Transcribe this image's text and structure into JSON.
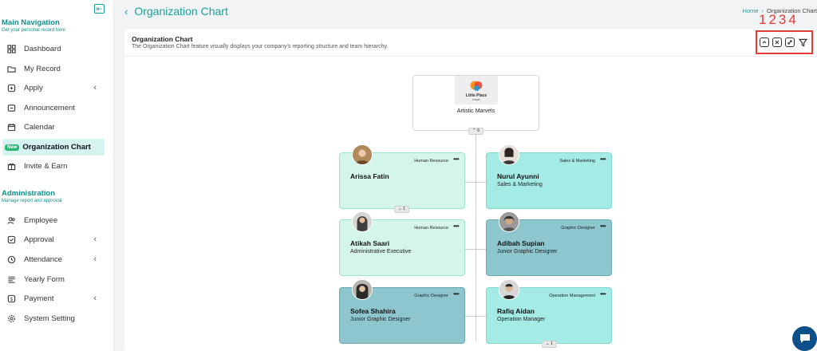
{
  "sidebar": {
    "main_nav": {
      "title": "Main Navigation",
      "subtitle": "Get your personal record here",
      "items": [
        {
          "label": "Dashboard",
          "icon": "grid-icon"
        },
        {
          "label": "My Record",
          "icon": "folder-icon"
        },
        {
          "label": "Apply",
          "icon": "apply-icon",
          "chevron": "‹"
        },
        {
          "label": "Announcement",
          "icon": "announcement-icon"
        },
        {
          "label": "Calendar",
          "icon": "calendar-icon"
        },
        {
          "label": "Organization Chart",
          "icon": "org-chart-icon",
          "badge": "New",
          "active": true
        },
        {
          "label": "Invite & Earn",
          "icon": "gift-icon"
        }
      ]
    },
    "admin": {
      "title": "Administration",
      "subtitle": "Manage report and approval",
      "items": [
        {
          "label": "Employee",
          "icon": "users-icon"
        },
        {
          "label": "Approval",
          "icon": "check-icon",
          "chevron": "‹"
        },
        {
          "label": "Attendance",
          "icon": "clock-icon",
          "chevron": "‹"
        },
        {
          "label": "Yearly Form",
          "icon": "form-icon"
        },
        {
          "label": "Payment",
          "icon": "dollar-icon",
          "chevron": "‹"
        },
        {
          "label": "System Setting",
          "icon": "gear-icon"
        }
      ]
    }
  },
  "header": {
    "title": "Organization Chart",
    "breadcrumb": {
      "home": "Home",
      "current": "Organization Chart"
    }
  },
  "card": {
    "title": "Organization Chart",
    "description": "The Organization Chart feature visually displays your company's reporting structure and team hierarchy.",
    "annotation_numbers": "1234",
    "toolbar": [
      "collapse-up-icon",
      "fit-screen-icon",
      "expand-icon",
      "filter-icon"
    ]
  },
  "org": {
    "root": {
      "logo_text_1": "Little Place",
      "logo_text_2": "START",
      "name": "Artistic Marvels",
      "expand": "⌃ 6"
    },
    "employees": [
      {
        "name": "Arissa Fatin",
        "role": "",
        "dept": "Human Resource",
        "color": "mint",
        "expand": "⌄ 1"
      },
      {
        "name": "Nurul Ayunni",
        "role": "Sales & Marketing",
        "dept": "Sales & Marketing",
        "color": "aqua"
      },
      {
        "name": "Atikah Saari",
        "role": "Administrative Executive",
        "dept": "Human Resource",
        "color": "mint"
      },
      {
        "name": "Adibah Supian",
        "role": "Junior Graphic Designer",
        "dept": "Graphic Designer",
        "color": "teal"
      },
      {
        "name": "Sofea Shahira",
        "role": "Junior Graphic Designer",
        "dept": "Graphic Designer",
        "color": "teal"
      },
      {
        "name": "Rafiq Aidan",
        "role": "Operation Manager",
        "dept": "Operation Management",
        "color": "aqua",
        "expand": "⌄ 1"
      }
    ],
    "more_dots": "•••"
  },
  "colors": {
    "accent": "#14a3a0",
    "annotation": "#e53935",
    "chat": "#0d4f8b"
  }
}
